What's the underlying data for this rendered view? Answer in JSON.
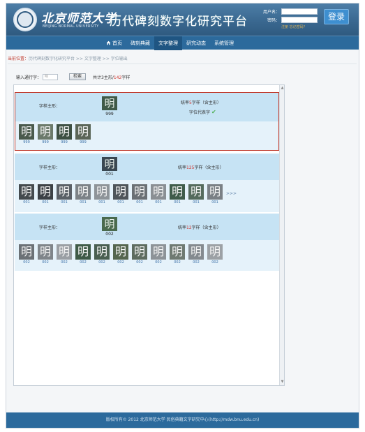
{
  "header": {
    "university_cn": "北京师范大学",
    "university_en": "BEIJING NORMAL UNIVERSITY",
    "site_title": "历代碑刻数字化研究平台",
    "username_label": "用户名：",
    "password_label": "密码：",
    "register_link": "注册",
    "forgot_link": "忘记密码？",
    "login_button": "登录"
  },
  "nav": {
    "items": [
      {
        "label": "首页"
      },
      {
        "label": "碑刻典藏"
      },
      {
        "label": "文字整理"
      },
      {
        "label": "研究动态"
      },
      {
        "label": "系统管理"
      }
    ]
  },
  "breadcrumb": {
    "lead": "当前位置：",
    "path": "历代碑刻数字化研究平台 >> 文字整理 >> 字位输出"
  },
  "search": {
    "label": "输入通行字：",
    "value": "明",
    "button": "检索",
    "count_prefix": "共计3主形/",
    "count_total": "142",
    "count_suffix": "字样"
  },
  "groups": [
    {
      "label": "字样主形：",
      "main_char": "明",
      "main_num": "999",
      "stat_prefix": "统率",
      "stat_count": "5",
      "stat_suffix": "字样（含主形）",
      "representative": "字位代表字",
      "glyphs": [
        {
          "char": "明",
          "num": "999",
          "color": "#4a5a4c"
        },
        {
          "char": "明",
          "num": "999",
          "color": "#6c7a6b"
        },
        {
          "char": "明",
          "num": "999",
          "color": "#3e5043"
        },
        {
          "char": "明",
          "num": "999",
          "color": "#5b6658"
        }
      ],
      "more": ""
    },
    {
      "label": "字样主形：",
      "main_char": "明",
      "main_num": "001",
      "stat_prefix": "统率",
      "stat_count": "125",
      "stat_suffix": "字样（含主形）",
      "representative": "",
      "glyphs": [
        {
          "char": "明",
          "num": "001",
          "color": "#444a4e"
        },
        {
          "char": "明",
          "num": "001",
          "color": "#3c4146"
        },
        {
          "char": "明",
          "num": "001",
          "color": "#5a6067"
        },
        {
          "char": "明",
          "num": "001",
          "color": "#7c8287"
        },
        {
          "char": "明",
          "num": "001",
          "color": "#8e9499"
        },
        {
          "char": "明",
          "num": "001",
          "color": "#4f555a"
        },
        {
          "char": "明",
          "num": "001",
          "color": "#6a7075"
        },
        {
          "char": "明",
          "num": "001",
          "color": "#8a8f94"
        },
        {
          "char": "明",
          "num": "001",
          "color": "#3f5c4a"
        },
        {
          "char": "明",
          "num": "001",
          "color": "#556b5d"
        },
        {
          "char": "明",
          "num": "001",
          "color": "#7a8085"
        }
      ],
      "more": ">>>"
    },
    {
      "label": "字样主形：",
      "main_char": "明",
      "main_num": "002",
      "stat_prefix": "统率",
      "stat_count": "12",
      "stat_suffix": "字样（含主形）",
      "representative": "",
      "glyphs": [
        {
          "char": "明",
          "num": "002",
          "color": "#6b7176"
        },
        {
          "char": "明",
          "num": "002",
          "color": "#7f858a"
        },
        {
          "char": "明",
          "num": "002",
          "color": "#9a9fa4"
        },
        {
          "char": "明",
          "num": "002",
          "color": "#3e5a47"
        },
        {
          "char": "明",
          "num": "002",
          "color": "#4a5f51"
        },
        {
          "char": "明",
          "num": "002",
          "color": "#55664f"
        },
        {
          "char": "明",
          "num": "002",
          "color": "#5e6c60"
        },
        {
          "char": "明",
          "num": "002",
          "color": "#8d9398"
        },
        {
          "char": "明",
          "num": "002",
          "color": "#6f7a72"
        },
        {
          "char": "明",
          "num": "002",
          "color": "#848a8f"
        },
        {
          "char": "明",
          "num": "002",
          "color": "#9ca1a5"
        }
      ],
      "more": ""
    }
  ],
  "footer": {
    "text": "版权所有© 2012 北京师范大学 民俗典籍文字研究中心(http://mdw.bnu.edu.cn)"
  },
  "colors": {
    "header_blue": "#3a6890",
    "nav_blue": "#2c6a9c",
    "nav_active": "#1f5582",
    "group_head": "#c6e3f4",
    "group_body": "#e5f2fa",
    "highlight_red": "#d0342c",
    "check_green": "#4caf50"
  },
  "icons": {
    "home": "home-icon",
    "check": "check-icon",
    "seal": "university-seal-icon"
  }
}
